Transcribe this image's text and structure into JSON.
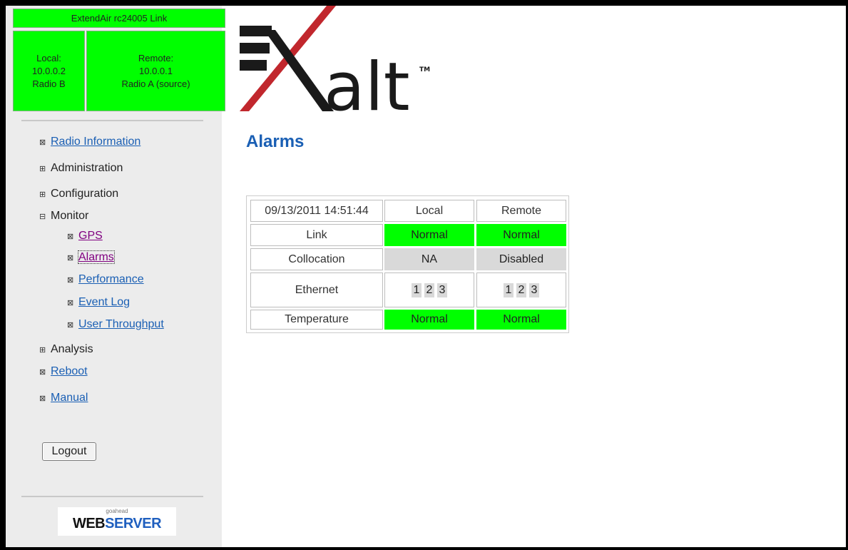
{
  "status": {
    "link_title": "ExtendAir rc24005 Link",
    "local": {
      "line1": "Local:",
      "line2": "10.0.0.2",
      "line3": "Radio B"
    },
    "remote": {
      "line1": "Remote:",
      "line2": "10.0.0.1",
      "line3": "Radio A (source)"
    },
    "color": "#00ff00"
  },
  "nav": {
    "radio_information": "Radio Information",
    "administration": "Administration",
    "configuration": "Configuration",
    "monitor": "Monitor",
    "gps": "GPS",
    "alarms": "Alarms",
    "performance": "Performance",
    "event_log": "Event Log",
    "user_throughput": "User Throughput",
    "analysis": "Analysis",
    "reboot": "Reboot",
    "manual": "Manual",
    "logout": "Logout"
  },
  "logo": {
    "text": "alt",
    "tm": "TM"
  },
  "footer": {
    "small": "goahead",
    "web": "WEB",
    "server": "SERVER"
  },
  "page": {
    "title": "Alarms"
  },
  "alarms_table": {
    "timestamp": "09/13/2011 14:51:44",
    "col_local": "Local",
    "col_remote": "Remote",
    "rows": [
      {
        "label": "Link",
        "local": "Normal",
        "remote": "Normal"
      },
      {
        "label": "Collocation",
        "local": "NA",
        "remote": "Disabled"
      },
      {
        "label": "Ethernet",
        "local_ports": [
          "1",
          "2",
          "3"
        ],
        "remote_ports": [
          "1",
          "2",
          "3"
        ]
      },
      {
        "label": "Temperature",
        "local": "Normal",
        "remote": "Normal"
      }
    ]
  },
  "colors": {
    "accent_blue": "#1a5fb4",
    "status_green": "#00ff00",
    "na_gray": "#d9d9d9",
    "logo_red": "#c1272d"
  },
  "icons": {
    "leaf": "x-box-icon",
    "expand": "plus-box-icon",
    "collapse": "minus-box-icon"
  }
}
